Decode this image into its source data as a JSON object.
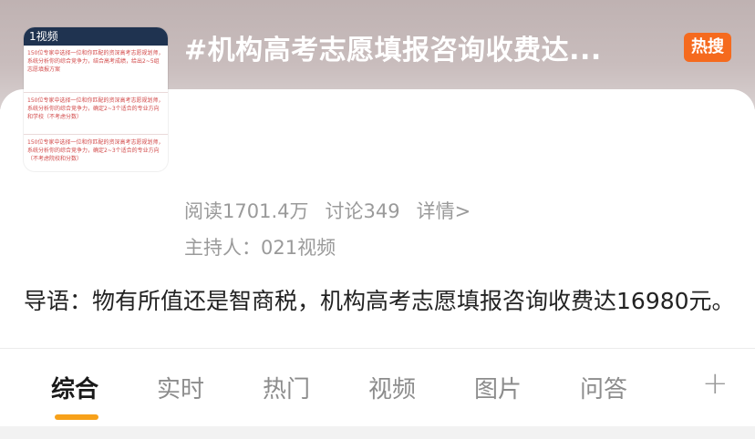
{
  "header": {
    "title": "#机构高考志愿填报咨询收费达...",
    "badge": "热搜",
    "thumbnail": {
      "heading": "1视频",
      "blocks": [
        "150位专家中选择一位和你匹配的资深高考志愿规划师，系统分析你的综合竞争力，结合高考成绩，给出2~5组志愿填报方案",
        "150位专家中选择一位和你匹配的资深高考志愿规划师，系统分析你的综合竞争力，确定2~3个适合的专业方向和学校（不考虑分数）",
        "150位专家中选择一位和你匹配的资深高考志愿规划师，系统分析你的综合竞争力，确定2~3个适合的专业方向（不考虑院校和分数）"
      ]
    }
  },
  "stats": {
    "reads": "阅读1701.4万",
    "discussions": "讨论349",
    "details": "详情>"
  },
  "host": "主持人：021视频",
  "intro": "导语：物有所值还是智商税，机构高考志愿填报咨询收费达16980元。",
  "tabs": [
    {
      "label": "综合"
    },
    {
      "label": "实时"
    },
    {
      "label": "热门"
    },
    {
      "label": "视频"
    },
    {
      "label": "图片"
    },
    {
      "label": "问答"
    }
  ],
  "tab_more": "+",
  "colors": {
    "accent_underline": "#f7a11a",
    "hot_badge": "#f56a1e"
  }
}
